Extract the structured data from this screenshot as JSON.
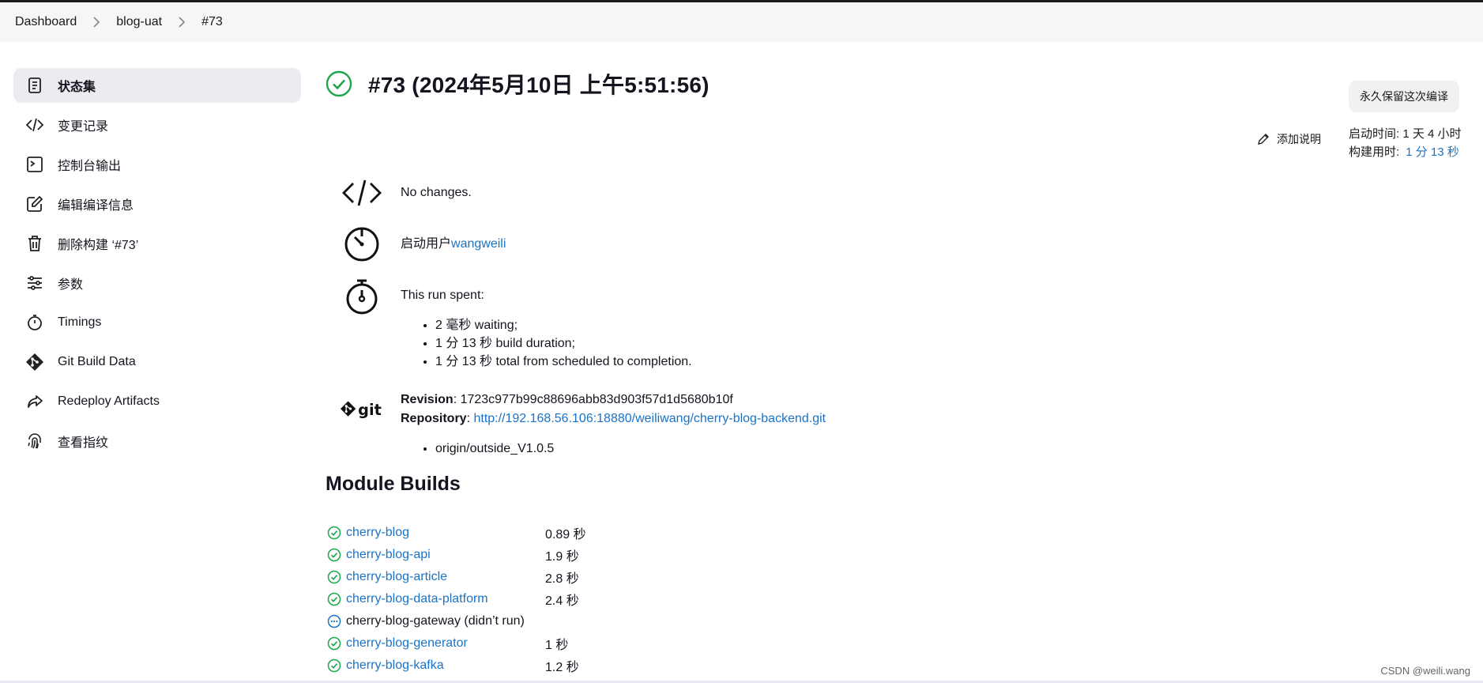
{
  "breadcrumb": [
    "Dashboard",
    "blog-uat",
    "#73"
  ],
  "sidebar": {
    "items": [
      {
        "label": "状态集",
        "icon": "document-icon"
      },
      {
        "label": "变更记录",
        "icon": "code-icon"
      },
      {
        "label": "控制台输出",
        "icon": "terminal-icon"
      },
      {
        "label": "编辑编译信息",
        "icon": "edit-icon"
      },
      {
        "label": "删除构建 ‘#73’",
        "icon": "trash-icon"
      },
      {
        "label": "参数",
        "icon": "sliders-icon"
      },
      {
        "label": "Timings",
        "icon": "stopwatch-icon"
      },
      {
        "label": "Git Build Data",
        "icon": "git-icon"
      },
      {
        "label": "Redeploy Artifacts",
        "icon": "redeploy-icon"
      },
      {
        "label": "查看指纹",
        "icon": "fingerprint-icon"
      }
    ]
  },
  "build": {
    "title": "#73 (2024年5月10日 上午5:51:56)",
    "keep_button": "永久保留这次编译",
    "add_description": "添加说明",
    "started_label": "启动时间: 1 天 4 小时",
    "duration_label": "构建用时:",
    "duration_value": "1 分 13 秒"
  },
  "changes": {
    "text": "No changes."
  },
  "started_by": {
    "prefix": "启动用户",
    "user": "wangweili"
  },
  "timing": {
    "heading": "This run spent:",
    "items": [
      "2 毫秒 waiting;",
      "1 分 13 秒 build duration;",
      "1 分 13 秒 total from scheduled to completion."
    ]
  },
  "git": {
    "revision_label": "Revision",
    "revision": ": 1723c977b99c88696abb83d903f57d1d5680b10f",
    "repository_label": "Repository",
    "repository_sep": ": ",
    "repository": "http://192.168.56.106:18880/weiliwang/cherry-blog-backend.git",
    "branches": [
      "origin/outside_V1.0.5"
    ]
  },
  "modules": {
    "title": "Module Builds",
    "rows": [
      {
        "name": "cherry-blog",
        "duration": "0.89 秒",
        "status": "success"
      },
      {
        "name": "cherry-blog-api",
        "duration": "1.9 秒",
        "status": "success"
      },
      {
        "name": "cherry-blog-article",
        "duration": "2.8 秒",
        "status": "success"
      },
      {
        "name": "cherry-blog-data-platform",
        "duration": "2.4 秒",
        "status": "success"
      },
      {
        "name": "cherry-blog-gateway (didn’t run)",
        "duration": "",
        "status": "not-run"
      },
      {
        "name": "cherry-blog-generator",
        "duration": "1 秒",
        "status": "success"
      },
      {
        "name": "cherry-blog-kafka",
        "duration": "1.2 秒",
        "status": "success"
      }
    ]
  },
  "watermark": "CSDN @weili.wang",
  "colors": {
    "accent": "#1a73c7",
    "success": "#1ea64b",
    "active_bg": "#ececf0"
  }
}
